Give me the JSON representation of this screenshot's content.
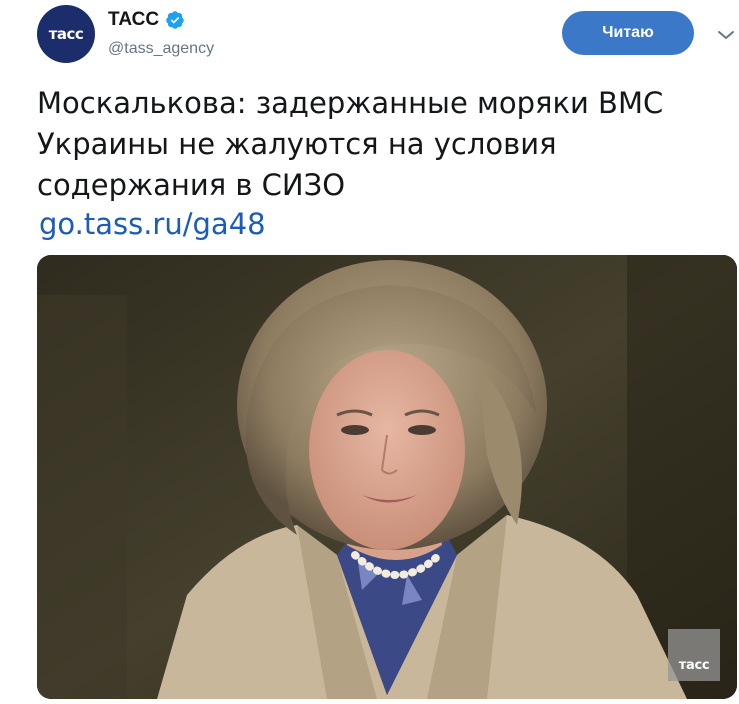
{
  "author": {
    "avatar_text": "тасс",
    "display_name": "ТАСС",
    "handle": "@tass_agency",
    "verified": true
  },
  "follow_button": {
    "label": "Читаю",
    "color": "#3b78c8"
  },
  "tweet": {
    "text": "Москалькова: задержанные моряки ВМС Украины не жалуются на условия содержания в СИЗО",
    "link": "go.tass.ru/ga48"
  },
  "photo": {
    "description_icon": "portrait-photo",
    "watermark_text": "тасс"
  },
  "icons": {
    "verified": "verified-badge-icon",
    "caret": "chevron-down-icon"
  },
  "colors": {
    "link": "#1b5cb8",
    "handle": "#657786",
    "avatar_bg": "#1c2d6b",
    "verified": "#1da1f2"
  }
}
